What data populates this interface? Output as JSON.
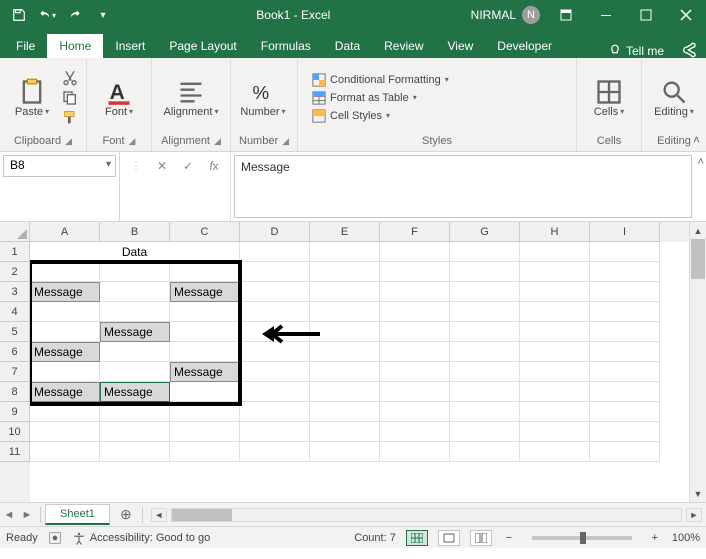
{
  "titlebar": {
    "title": "Book1 - Excel",
    "user_name": "NIRMAL",
    "user_initial": "N"
  },
  "tabs": {
    "file": "File",
    "home": "Home",
    "insert": "Insert",
    "page_layout": "Page Layout",
    "formulas": "Formulas",
    "data": "Data",
    "review": "Review",
    "view": "View",
    "developer": "Developer",
    "tell_me": "Tell me"
  },
  "ribbon": {
    "clipboard": {
      "paste": "Paste",
      "label": "Clipboard"
    },
    "font": {
      "btn": "Font",
      "label": "Font"
    },
    "alignment": {
      "btn": "Alignment",
      "label": "Alignment"
    },
    "number": {
      "btn": "Number",
      "label": "Number"
    },
    "styles": {
      "cond_format": "Conditional Formatting",
      "format_table": "Format as Table",
      "cell_styles": "Cell Styles",
      "label": "Styles"
    },
    "cells": {
      "btn": "Cells",
      "label": "Cells"
    },
    "editing": {
      "btn": "Editing",
      "label": "Editing"
    }
  },
  "formula_bar": {
    "name_box": "B8",
    "formula": "Message"
  },
  "columns": [
    "A",
    "B",
    "C",
    "D",
    "E",
    "F",
    "G",
    "H",
    "I"
  ],
  "rows": [
    "1",
    "2",
    "3",
    "4",
    "5",
    "6",
    "7",
    "8",
    "9",
    "10",
    "11"
  ],
  "cells": {
    "A1_merged": "Data",
    "A3": "Message",
    "C3": "Message",
    "B5": "Message",
    "A6": "Message",
    "C7": "Message",
    "A8": "Message",
    "B8": "Message"
  },
  "sheet_tabs": {
    "sheet1": "Sheet1"
  },
  "status": {
    "ready": "Ready",
    "accessibility": "Accessibility: Good to go",
    "count_label": "Count:",
    "count_value": "7",
    "zoom": "100%"
  }
}
